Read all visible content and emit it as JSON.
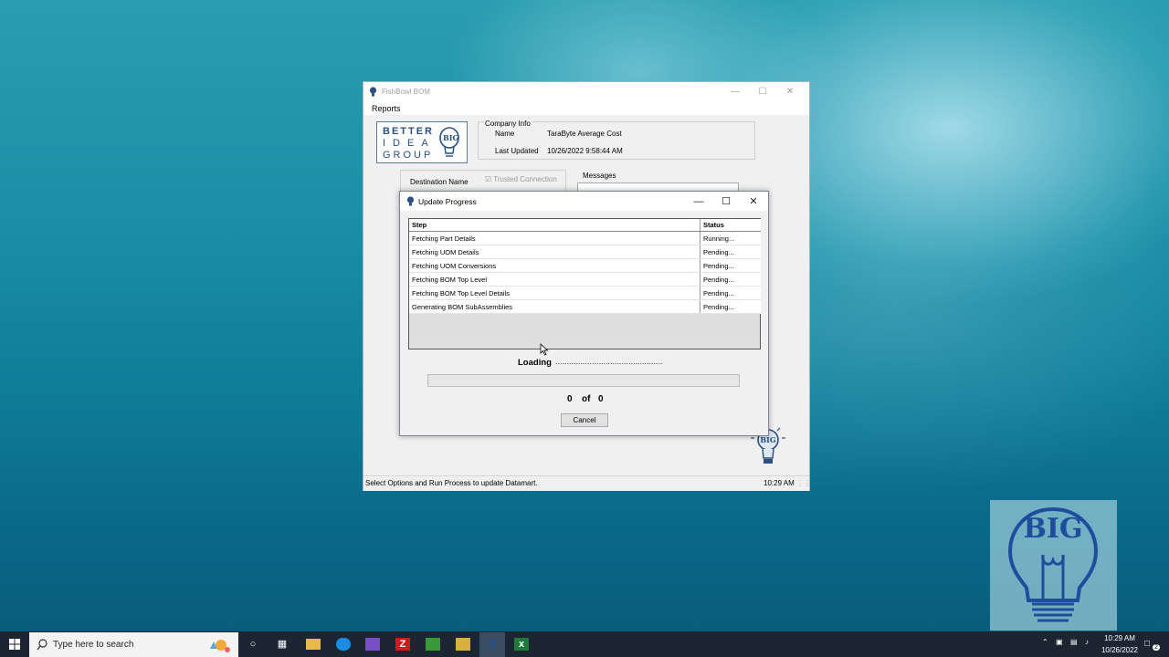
{
  "main_window": {
    "title": "FishBowl BOM",
    "menu": [
      "Reports"
    ],
    "logo_lines": [
      "BETTER",
      "IDEA",
      "GROUP"
    ],
    "logo_badge": "BIG",
    "company_info": {
      "legend": "Company Info",
      "name_label": "Name",
      "name_value": "TaraByte Average Cost",
      "updated_label": "Last Updated",
      "updated_value": "10/26/2022 9:58:44 AM"
    },
    "destination_label": "Destination Name",
    "trusted_label": "Trusted Connection",
    "messages_label": "Messages",
    "status_text": "Select Options and Run Process to update Datamart.",
    "status_time": "10:29 AM"
  },
  "dialog": {
    "title": "Update Progress",
    "columns": [
      "Step",
      "Status"
    ],
    "rows": [
      {
        "step": "Fetching Part Details",
        "status": "Running..."
      },
      {
        "step": "Fetching UOM Details",
        "status": "Pending..."
      },
      {
        "step": "Fetching UOM Conversions",
        "status": "Pending..."
      },
      {
        "step": "Fetching BOM Top Level",
        "status": "Pending..."
      },
      {
        "step": "Fetching BOM Top Level Details",
        "status": "Pending..."
      },
      {
        "step": "Generating BOM SubAssemblies",
        "status": "Pending..."
      }
    ],
    "loading_text": "Loading",
    "loading_dots": "...............................................",
    "progress": 0,
    "count_current": "0",
    "count_of": "of",
    "count_total": "0",
    "cancel_label": "Cancel"
  },
  "overlay_logo": "BIG",
  "taskbar": {
    "search_placeholder": "Type here to search",
    "time": "10:29 AM",
    "date": "10/26/2022",
    "notification_count": "2"
  },
  "colors": {
    "logo_blue": "#2a4f80",
    "taskbar": "#1c2632"
  }
}
